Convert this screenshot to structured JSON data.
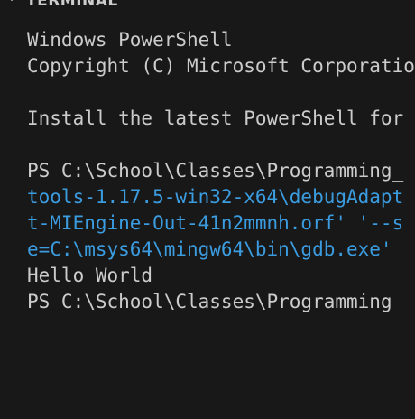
{
  "panel": {
    "title": "TERMINAL",
    "chevron_icon": "chevron-down-icon"
  },
  "terminal": {
    "colors": {
      "background": "#181818",
      "text": "#cccccc",
      "command": "#3b9ce0"
    },
    "lines": [
      "Windows PowerShell",
      "Copyright (C) Microsoft Corporatio",
      "",
      "Install the latest PowerShell for",
      "",
      "PS C:\\School\\Classes\\Programming_",
      "tools-1.17.5-win32-x64\\debugAdapt",
      "t-MIEngine-Out-41n2mmnh.orf' '--s",
      "e=C:\\msys64\\mingw64\\bin\\gdb.exe'",
      "Hello World",
      "PS C:\\School\\Classes\\Programming_"
    ]
  }
}
